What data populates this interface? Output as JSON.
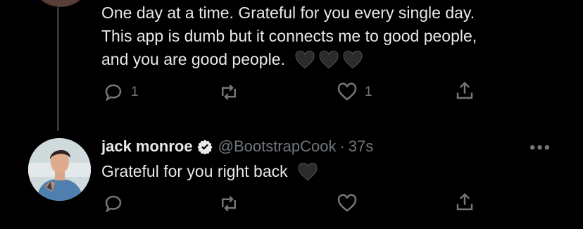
{
  "thread_tweet": {
    "lines": [
      "One day at a time. Grateful for you every single day.",
      "This app is dumb but it connects me to good people,",
      "and you are good people."
    ],
    "actions": {
      "reply_count": "1",
      "retweet_count": "",
      "like_count": "1"
    }
  },
  "reply_tweet": {
    "name": "jack monroe",
    "handle": "@BootstrapCook",
    "separator": "·",
    "time": "37s",
    "text": "Grateful for you right back",
    "more": "•••"
  },
  "icons": {
    "reply": "reply-icon",
    "retweet": "retweet-icon",
    "like": "heart-icon",
    "share": "share-icon",
    "verified": "verified-badge-icon",
    "emoji": "black-heart-emoji"
  },
  "colors": {
    "background": "#000000",
    "text": "#e7e9ea",
    "muted": "#71767b",
    "thread_line": "#333639"
  }
}
